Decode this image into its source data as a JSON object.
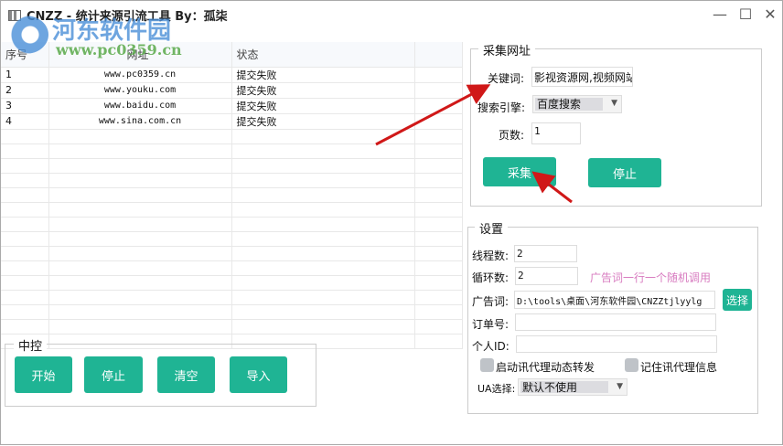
{
  "window": {
    "title": "CNZZ - 统计来源引流工具 By：孤柒",
    "minimize": "—",
    "maximize": "☐",
    "close": "✕"
  },
  "watermark": {
    "name": "河东软件园",
    "url": "www.pc0359.cn"
  },
  "table": {
    "headers": [
      "序号",
      "网址",
      "状态"
    ],
    "rows": [
      [
        "1",
        "www.pc0359.cn",
        "提交失败"
      ],
      [
        "2",
        "www.youku.com",
        "提交失败"
      ],
      [
        "3",
        "www.baidu.com",
        "提交失败"
      ],
      [
        "4",
        "www.sina.com.cn",
        "提交失败"
      ]
    ]
  },
  "control": {
    "legend": "中控",
    "start": "开始",
    "stop": "停止",
    "clear": "清空",
    "import": "导入"
  },
  "collect": {
    "legend": "采集网址",
    "keyword_label": "关键词:",
    "keyword_value": "影视资源网,视频网站",
    "engine_label": "搜索引擎:",
    "engine_value": "百度搜索",
    "pages_label": "页数:",
    "pages_value": "1",
    "collect_btn": "采集",
    "stop_btn": "停止"
  },
  "settings": {
    "legend": "设置",
    "threads_label": "线程数:",
    "threads_value": "2",
    "loops_label": "循环数:",
    "loops_value": "2",
    "hint": "广告词一行一个随机调用",
    "ad_label": "广告词:",
    "ad_value": "D:\\tools\\桌面\\河东软件园\\CNZZtjlyylg",
    "choose_btn": "选择",
    "order_label": "订单号:",
    "order_value": "",
    "id_label": "个人ID:",
    "id_value": "",
    "proxy_dynamic": "启动讯代理动态转发",
    "proxy_remember": "记住讯代理信息",
    "ua_label": "UA选择:",
    "ua_value": "默认不使用"
  }
}
